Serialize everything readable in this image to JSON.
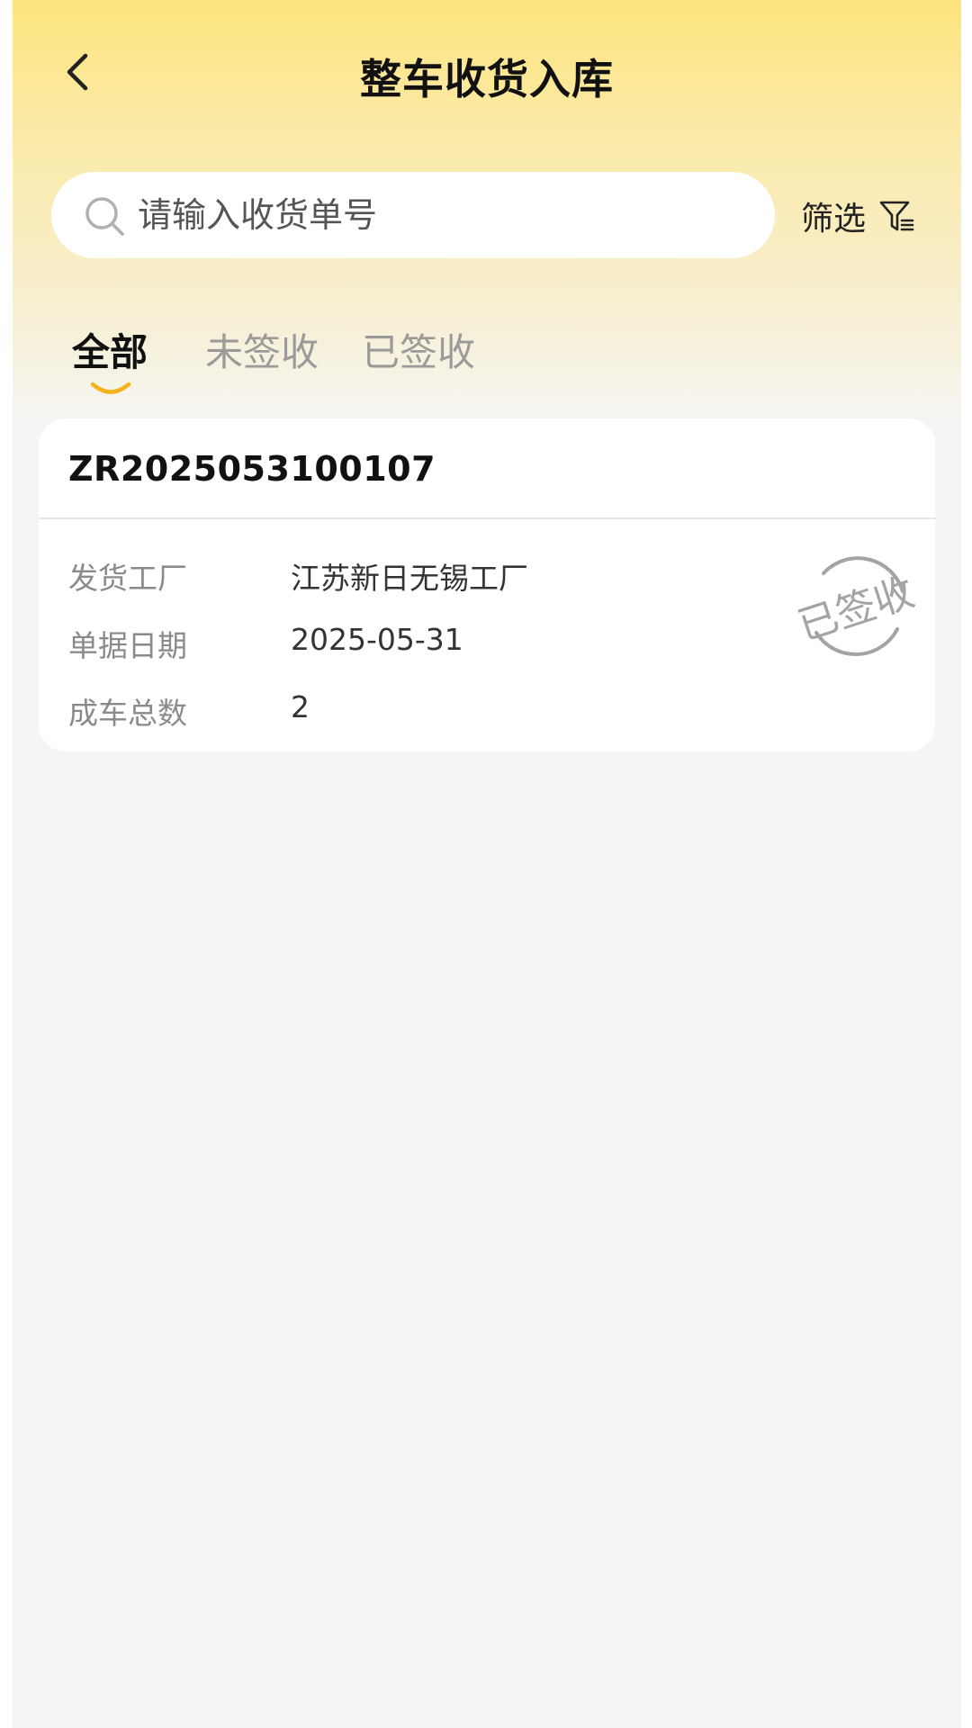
{
  "header": {
    "title": "整车收货入库",
    "back_icon": "chevron-left-icon"
  },
  "search": {
    "placeholder": "请输入收货单号",
    "value": "",
    "icon": "search-icon"
  },
  "filter": {
    "label": "筛选",
    "icon": "filter-icon"
  },
  "tabs": [
    {
      "label": "全部",
      "active": true
    },
    {
      "label": "未签收",
      "active": false
    },
    {
      "label": "已签收",
      "active": false
    }
  ],
  "orders": [
    {
      "order_no": "ZR2025053100107",
      "fields": [
        {
          "label": "发货工厂",
          "value": "江苏新日无锡工厂"
        },
        {
          "label": "单据日期",
          "value": "2025-05-31"
        },
        {
          "label": "成车总数",
          "value": "2"
        }
      ],
      "stamp": "已签收"
    }
  ],
  "colors": {
    "header_gradient_top": "#fde47d",
    "page_background": "#f5f5f5",
    "tab_indicator": "#f5b11a",
    "stamp": "#a4a4a4"
  }
}
